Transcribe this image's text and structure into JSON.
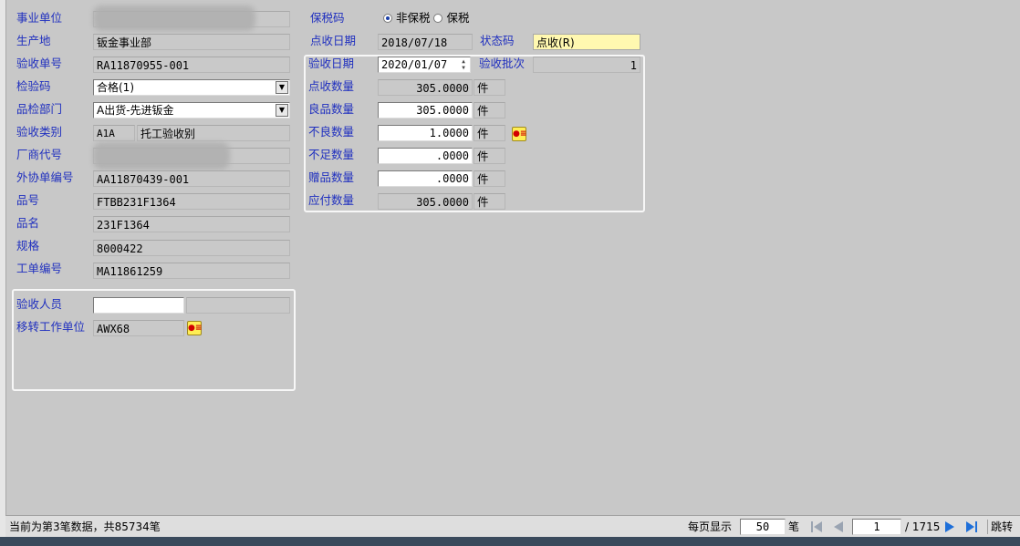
{
  "left": {
    "business_unit": {
      "label": "事业单位",
      "value": ""
    },
    "origin": {
      "label": "生产地",
      "value": "钣金事业部"
    },
    "receipt_no": {
      "label": "验收单号",
      "value": "RA11870955-001"
    },
    "inspection_code": {
      "label": "检验码",
      "value": "合格(1)"
    },
    "qc_dept": {
      "label": "品检部门",
      "value": "A出货-先进钣金"
    },
    "receipt_type": {
      "label": "验收类别",
      "code": "A1A",
      "desc": "托工验收别"
    },
    "vendor_code": {
      "label": "厂商代号",
      "value": ""
    },
    "outsource_no": {
      "label": "外协单编号",
      "value": "AA11870439-001"
    },
    "part_no": {
      "label": "品号",
      "value": "FTBB231F1364"
    },
    "part_name": {
      "label": "品名",
      "value": "231F1364"
    },
    "spec": {
      "label": "规格",
      "value": "8000422"
    },
    "work_order": {
      "label": "工单编号",
      "value": "MA11861259"
    }
  },
  "staff_group": {
    "inspector": {
      "label": "验收人员",
      "value": "",
      "name": ""
    },
    "transfer_unit": {
      "label": "移转工作单位",
      "value": "AWX68"
    }
  },
  "right": {
    "bonded": {
      "label": "保税码",
      "opt1": "非保税",
      "opt2": "保税",
      "selected": "非保税"
    },
    "count_date": {
      "label": "点收日期",
      "value": "2018/07/18"
    },
    "status_code": {
      "label": "状态码",
      "value": "点收(R)"
    },
    "accept_date": {
      "label": "验收日期",
      "value": "2020/01/07"
    },
    "batch": {
      "label": "验收批次",
      "value": "1"
    },
    "count_qty": {
      "label": "点收数量",
      "value": "305.0000",
      "unit": "件"
    },
    "good_qty": {
      "label": "良品数量",
      "value": "305.0000",
      "unit": "件"
    },
    "defect_qty": {
      "label": "不良数量",
      "value": "1.0000",
      "unit": "件"
    },
    "short_qty": {
      "label": "不足数量",
      "value": ".0000",
      "unit": "件"
    },
    "gift_qty": {
      "label": "赠品数量",
      "value": ".0000",
      "unit": "件"
    },
    "payable_qty": {
      "label": "应付数量",
      "value": "305.0000",
      "unit": "件"
    }
  },
  "statusbar": {
    "record_info": "当前为第3笔数据，共85734笔",
    "per_page_label": "每页显示",
    "per_page": "50",
    "per_page_unit": "笔",
    "page": "1",
    "total_pages": "/ 1715",
    "jump": "跳转"
  },
  "colors": {
    "label": "#1f2fbf",
    "background": "#c8c8c8",
    "status_highlight": "#fff8b0",
    "nav_blue": "#1e6fd9"
  }
}
